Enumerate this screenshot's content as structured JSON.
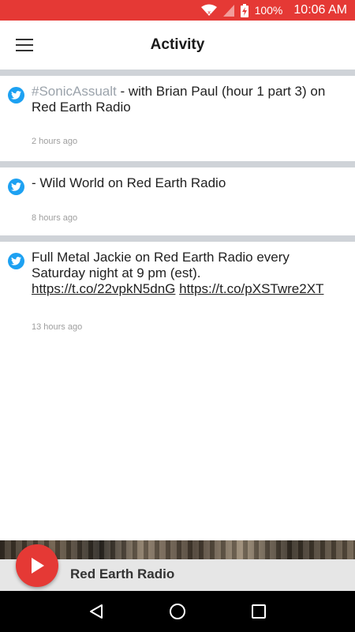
{
  "status_bar": {
    "battery": "100%",
    "time": "10:06 AM",
    "icons": [
      "wifi-icon",
      "signal-icon",
      "battery-charging-icon"
    ]
  },
  "header": {
    "title": "Activity",
    "menu_icon": "hamburger-menu-icon"
  },
  "feed": {
    "items": [
      {
        "source_icon": "twitter-icon",
        "hashtag": "#SonicAssualt",
        "text": " - with Brian Paul (hour 1 part 3) on Red Earth Radio",
        "time": "2 hours ago"
      },
      {
        "source_icon": "twitter-icon",
        "text": "- Wild World on Red Earth Radio",
        "time": "8 hours ago"
      },
      {
        "source_icon": "twitter-icon",
        "text": "Full Metal Jackie on Red Earth Radio every Saturday night at 9 pm (est). ",
        "link1": "https://t.co/22vpkN5dnG",
        "link2": "https://t.co/pXSTwre2XT",
        "time": "13 hours ago"
      }
    ]
  },
  "player": {
    "station": "Red Earth Radio",
    "play_icon": "play-icon"
  },
  "colors": {
    "accent": "#e53935",
    "twitter": "#1da1f2",
    "divider": "#cfd3d8",
    "player_bar": "#e6e6e6"
  },
  "nav_bar": {
    "icons": [
      "back-icon",
      "home-icon",
      "recents-icon"
    ]
  }
}
